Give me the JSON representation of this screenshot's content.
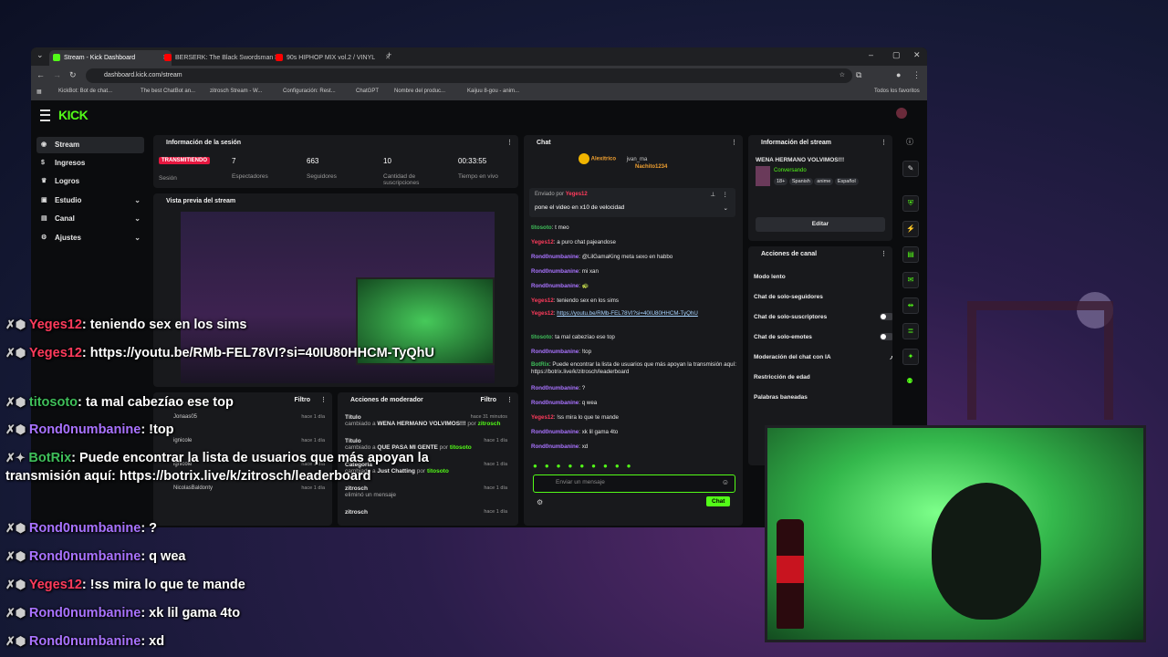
{
  "browser": {
    "tabs": [
      {
        "title": "Stream - Kick Dashboard",
        "active": true
      },
      {
        "title": "BERSERK: The Black Swordsman",
        "active": false
      },
      {
        "title": "90s HIPHOP MIX vol.2 / VINYL",
        "active": false
      }
    ],
    "url": "dashboard.kick.com/stream",
    "bookmarks": [
      "KickBot: Bot de chat...",
      "The best ChatBot an...",
      "zitrosch Stream - W...",
      "Configuración: Rest...",
      "ChatGPT",
      "Nombre del produc...",
      "Kaijuu 8-gou - anim..."
    ],
    "all_bookmarks": "Todos los favoritos"
  },
  "app": {
    "logo": "KICK",
    "sidebar": [
      {
        "label": "Stream",
        "icon": "stream-icon",
        "active": true,
        "chevron": false
      },
      {
        "label": "Ingresos",
        "icon": "money-icon",
        "active": false,
        "chevron": false
      },
      {
        "label": "Logros",
        "icon": "trophy-icon",
        "active": false,
        "chevron": false
      },
      {
        "label": "Estudio",
        "icon": "studio-icon",
        "active": false,
        "chevron": true
      },
      {
        "label": "Canal",
        "icon": "channel-icon",
        "active": false,
        "chevron": true
      },
      {
        "label": "Ajustes",
        "icon": "gear-icon",
        "active": false,
        "chevron": true
      }
    ],
    "session": {
      "title": "Información de la sesión",
      "live_badge": "TRANSMITIENDO",
      "session_label": "Sesión",
      "stats": [
        {
          "value": "7",
          "label": "Espectadores"
        },
        {
          "value": "663",
          "label": "Seguidores"
        },
        {
          "value": "10",
          "label": "Cantidad de suscripciones"
        },
        {
          "value": "00:33:55",
          "label": "Tiempo en vivo"
        }
      ]
    },
    "preview": {
      "title": "Vista previa del stream"
    },
    "chat_panel": {
      "title": "Chat",
      "filter": "Filtro"
    },
    "mod_actions": {
      "title": "Acciones de moderador",
      "filter": "Filtro",
      "rows": [
        {
          "title": "Título",
          "time": "hace 31 minutos",
          "desc_pre": "cambiado a ",
          "desc_bold": "WENA HERMANO VOLVIMOS!!!",
          "desc_by": " por ",
          "user": "zitrosch"
        },
        {
          "title": "Título",
          "time": "hace 1 día",
          "desc_pre": "cambiado a ",
          "desc_bold": "QUE PASA MI GENTE",
          "desc_by": " por ",
          "user": "titosoto"
        },
        {
          "title": "Categoría",
          "time": "hace 1 día",
          "desc_pre": "cambiado a ",
          "desc_bold": "Just Chatting",
          "desc_by": " por ",
          "user": "titosoto"
        },
        {
          "title": "zitrosch",
          "time": "hace 1 día",
          "desc_pre": "eliminó un mensaje",
          "desc_bold": "",
          "desc_by": "",
          "user": ""
        },
        {
          "title": "zitrosch",
          "time": "hace 1 día",
          "desc_pre": "",
          "desc_bold": "",
          "desc_by": "",
          "user": ""
        }
      ]
    },
    "chat": {
      "title": "Chat",
      "top_gifters": [
        "Alexitrico",
        "jvan_ma",
        "Nachito1234"
      ],
      "pinned_by_label": "Enviado por",
      "pinned_user": "Yeges12",
      "pinned_text": "pone el video en x10 de velocidad",
      "messages": [
        {
          "user": "titosoto",
          "color": "green",
          "text": "t meo"
        },
        {
          "user": "Yeges12",
          "color": "red",
          "text": "a puro chat pajeandose"
        },
        {
          "user": "Rond0numbanine",
          "color": "purple",
          "text": "@LilGamaKing meta sexo en habbo"
        },
        {
          "user": "Rond0numbanine",
          "color": "purple",
          "text": "mi xan"
        },
        {
          "user": "Rond0numbanine",
          "color": "purple",
          "text": ""
        },
        {
          "user": "Yeges12",
          "color": "red",
          "text": "teniendo sex en los sims"
        },
        {
          "user": "Yeges12",
          "color": "red",
          "text": "https://youtu.be/RMb-FEL78VI?si=40IU80HHCM-TyQhU"
        },
        {
          "user": "titosoto",
          "color": "green",
          "text": "ta mal cabezíao ese top"
        },
        {
          "user": "Rond0numbanine",
          "color": "purple",
          "text": "!top"
        },
        {
          "user": "BotRix",
          "color": "green",
          "text": "Puede encontrar la lista de usuarios que más apoyan la transmisión aquí: https://botrix.live/k/zitrosch/leaderboard"
        },
        {
          "user": "Rond0numbanine",
          "color": "purple",
          "text": "?"
        },
        {
          "user": "Rond0numbanine",
          "color": "purple",
          "text": "q wea"
        },
        {
          "user": "Yeges12",
          "color": "red",
          "text": "!ss mira lo que te mande"
        },
        {
          "user": "Rond0numbanine",
          "color": "purple",
          "text": "xk lil gama 4to"
        },
        {
          "user": "Rond0numbanine",
          "color": "purple",
          "text": "xd"
        }
      ],
      "input_placeholder": "Enviar un mensaje",
      "send_label": "Chat"
    },
    "stream_info": {
      "title": "Información del stream",
      "stream_title": "WENA HERMANO VOLVIMOS!!!",
      "category": "Conversando",
      "tags": [
        "18+",
        "Spanish",
        "anime",
        "Español"
      ],
      "edit_label": "Editar"
    },
    "channel_actions": {
      "title": "Acciones de canal",
      "items": [
        {
          "label": "Modo lento",
          "type": "arrow"
        },
        {
          "label": "Chat de solo-seguidores",
          "type": "arrow"
        },
        {
          "label": "Chat de solo-suscriptores",
          "type": "toggle"
        },
        {
          "label": "Chat de solo-emotes",
          "type": "toggle"
        },
        {
          "label": "Moderación del chat con IA",
          "type": "external"
        },
        {
          "label": "Restricción de edad",
          "type": "arrow"
        },
        {
          "label": "Palabras baneadas",
          "type": "arrow"
        }
      ]
    },
    "viewers_list": {
      "names": [
        "Jonaas05",
        "ignicole",
        "ignicole",
        "NicolasBaldonty"
      ],
      "times": [
        "hace 1 día",
        "hace 1 día",
        "hace 1 día",
        "hace 1 día"
      ]
    }
  },
  "overlay_chat": [
    {
      "user": "Yeges12",
      "color": "red",
      "text": "teniendo sex en los sims"
    },
    {
      "user": "Yeges12",
      "color": "red",
      "text": "https://youtu.be/RMb-FEL78VI?si=40IU80HHCM-TyQhU"
    },
    {
      "user": "titosoto",
      "color": "green",
      "text": "ta mal cabezíao ese top"
    },
    {
      "user": "Rond0numbanine",
      "color": "purple",
      "text": "!top"
    },
    {
      "user": "BotRix",
      "color": "green",
      "text": "Puede encontrar la lista de usuarios que más apoyan la transmisión aquí: https://botrix.live/k/zitrosch/leaderboard"
    },
    {
      "user": "Rond0numbanine",
      "color": "purple",
      "text": "?"
    },
    {
      "user": "Rond0numbanine",
      "color": "purple",
      "text": "q wea"
    },
    {
      "user": "Yeges12",
      "color": "red",
      "text": "!ss mira lo que te mande"
    },
    {
      "user": "Rond0numbanine",
      "color": "purple",
      "text": "xk lil gama 4to"
    },
    {
      "user": "Rond0numbanine",
      "color": "purple",
      "text": "xd"
    }
  ],
  "colors": {
    "kick_green": "#53fc18",
    "live_red": "#e5173f",
    "purple_user": "#a973ff",
    "red_user": "#ff3b5c"
  }
}
